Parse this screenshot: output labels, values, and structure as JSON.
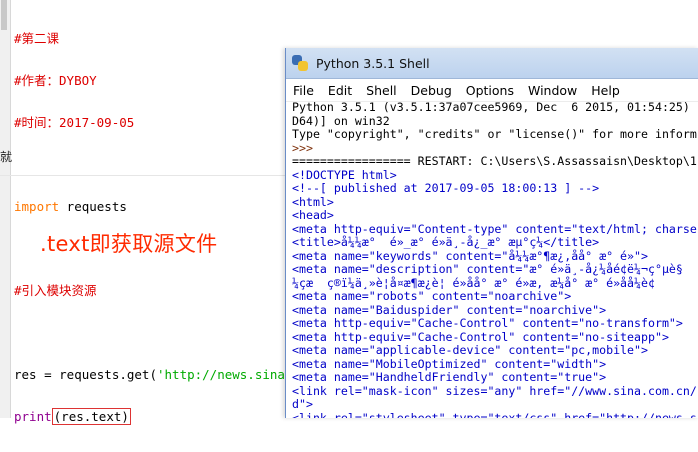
{
  "editor": {
    "lines": [
      {
        "text": "#第二课",
        "cls": "c-comment"
      },
      {
        "text": "#作者：DYBOY",
        "cls": "c-comment"
      },
      {
        "text": "#时间：2017-09-05",
        "cls": "c-comment"
      },
      {
        "text": "",
        "cls": "c-plain"
      },
      {
        "kw": "import",
        "rest": " requests"
      },
      {
        "text": "",
        "cls": "c-plain"
      },
      {
        "text": "#引入模块资源",
        "cls": "c-comment"
      },
      {
        "text": "",
        "cls": "c-plain"
      },
      {
        "pre": "res = requests.get(",
        "str": "'http://news.sina.cc"
      },
      {
        "builtin": "print",
        "boxed": "(res.text)"
      }
    ],
    "leftbar_cut_char": "就",
    "annotation": ".text即获取源文件"
  },
  "shell": {
    "title": "Python 3.5.1 Shell",
    "menu": [
      "File",
      "Edit",
      "Shell",
      "Debug",
      "Options",
      "Window",
      "Help"
    ],
    "output_lines": [
      {
        "text": "Python 3.5.1 (v3.5.1:37a07cee5969, Dec  6 2015, 01:54:25)",
        "c": "o-black"
      },
      {
        "text": "D64)] on win32",
        "c": "o-black"
      },
      {
        "text": "Type \"copyright\", \"credits\" or \"license()\" for more inform",
        "c": "o-black"
      },
      {
        "text": ">>>",
        "c": "o-brown"
      },
      {
        "text": "================= RESTART: C:\\Users\\S.Assassaisn\\Desktop\\1.",
        "c": "o-black"
      },
      {
        "text": "<!DOCTYPE html>",
        "c": "o-blue"
      },
      {
        "text": "<!--[ published at 2017-09-05 18:00:13 ] -->",
        "c": "o-blue"
      },
      {
        "text": "<html>",
        "c": "o-blue"
      },
      {
        "text": "<head>",
        "c": "o-blue"
      },
      {
        "text": "<meta http-equiv=\"Content-type\" content=\"text/html; charse",
        "c": "o-blue"
      },
      {
        "text": "<title>å¼¼æ°  é»_æ° é»ä¸-å¿_æ° æµ°ç¼</title>",
        "c": "o-blue"
      },
      {
        "text": "<meta name=\"keywords\" content=\"å¼¼æ°¶æ¿,åå° æ° é»\">",
        "c": "o-blue"
      },
      {
        "text": "<meta name=\"description\" content=\"æ° é»ä¸-å¿¼åé¢ë¼¬ç°µè§",
        "c": "o-blue"
      },
      {
        "text": "¼çæ  ç®ï¼ä¸»è¦å¤æ¶æ¿è¦ é»åå° æ° é»æ, æ¼å° æ° é»åå¼è¢",
        "c": "o-blue"
      },
      {
        "text": "<meta name=\"robots\" content=\"noarchive\">",
        "c": "o-blue"
      },
      {
        "text": "<meta name=\"Baiduspider\" content=\"noarchive\">",
        "c": "o-blue"
      },
      {
        "text": "<meta http-equiv=\"Cache-Control\" content=\"no-transform\">",
        "c": "o-blue"
      },
      {
        "text": "<meta http-equiv=\"Cache-Control\" content=\"no-siteapp\">",
        "c": "o-blue"
      },
      {
        "text": "<meta name=\"applicable-device\" content=\"pc,mobile\">",
        "c": "o-blue"
      },
      {
        "text": "<meta name=\"MobileOptimized\" content=\"width\">",
        "c": "o-blue"
      },
      {
        "text": "<meta name=\"HandheldFriendly\" content=\"true\">",
        "c": "o-blue"
      },
      {
        "text": "<link rel=\"mask-icon\" sizes=\"any\" href=\"//www.sina.com.cn/",
        "c": "o-blue"
      },
      {
        "text": "d\">",
        "c": "o-blue"
      },
      {
        "text": "<link rel=\"stylesheet\" type=\"text/css\" href=\"http://news.s",
        "c": "o-blue"
      }
    ]
  }
}
